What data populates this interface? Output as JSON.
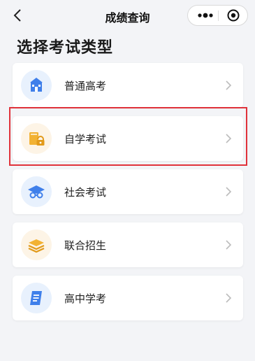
{
  "nav": {
    "title": "成绩查询",
    "back_icon": "chevron-left-icon",
    "more_icon": "more-dots-icon",
    "close_icon": "target-icon"
  },
  "heading": "选择考试类型",
  "items": [
    {
      "label": "普通高考",
      "icon": "school-building-icon",
      "icon_bg": "#e8f1fd"
    },
    {
      "label": "自学考试",
      "icon": "book-lock-icon",
      "icon_bg": "#fdf4e6"
    },
    {
      "label": "社会考试",
      "icon": "graduation-cap-icon",
      "icon_bg": "#e8f1fd"
    },
    {
      "label": "联合招生",
      "icon": "layers-icon",
      "icon_bg": "#fdf4e6"
    },
    {
      "label": "高中学考",
      "icon": "scroll-icon",
      "icon_bg": "#e8f1fd"
    }
  ],
  "colors": {
    "highlight": "#e0323a",
    "blue": "#3f7fea",
    "gold": "#f2b233"
  }
}
